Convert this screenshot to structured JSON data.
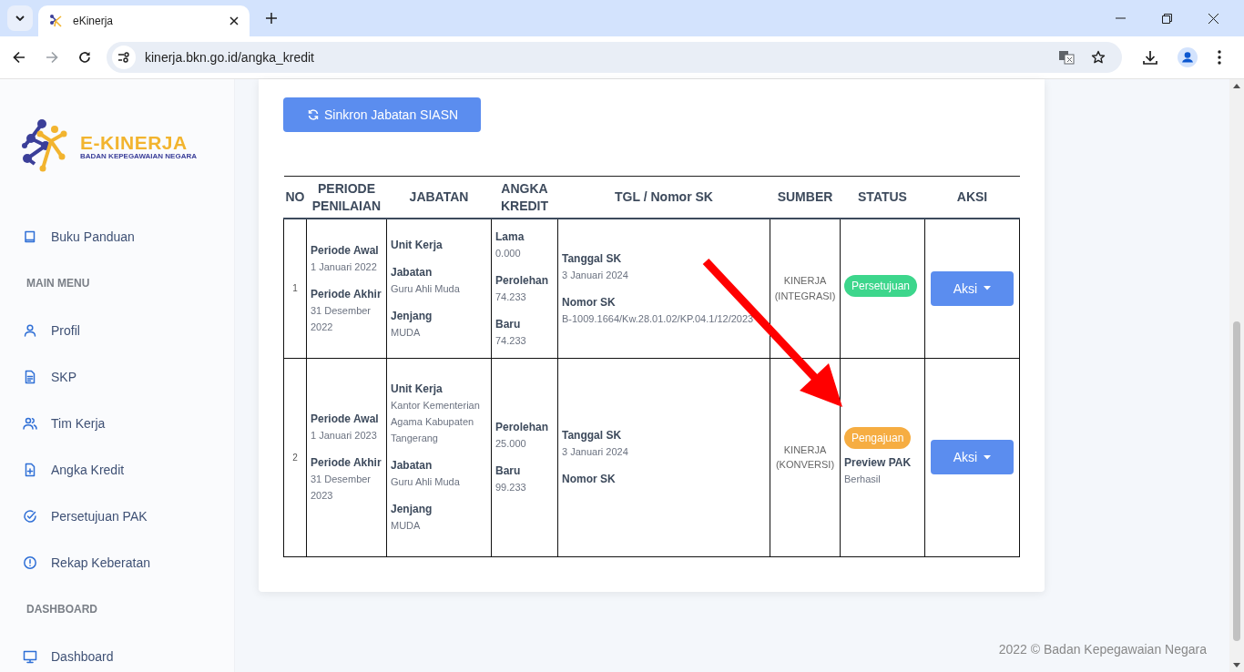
{
  "browser": {
    "tab_title": "eKinerja",
    "url": "kinerja.bkn.go.id/angka_kredit"
  },
  "sidebar": {
    "logo": {
      "title": "E-KINERJA",
      "subtitle": "BADAN KEPEGAWAIAN NEGARA"
    },
    "sections": [
      {
        "items": [
          "Buku Panduan"
        ]
      },
      {
        "heading": "MAIN MENU",
        "items": [
          "Profil",
          "SKP",
          "Tim Kerja",
          "Angka Kredit",
          "Persetujuan PAK",
          "Rekap Keberatan"
        ]
      },
      {
        "heading": "DASHBOARD",
        "items": [
          "Dashboard"
        ]
      }
    ]
  },
  "sync_button": "Sinkron Jabatan SIASN",
  "table": {
    "columns": [
      "NO",
      "PERIODE PENILAIAN",
      "JABATAN",
      "ANGKA KREDIT",
      "TGL / Nomor SK",
      "SUMBER",
      "STATUS",
      "AKSI"
    ],
    "rows": [
      {
        "no": "1",
        "periode": [
          {
            "label": "Periode Awal",
            "value": "1 Januari 2022"
          },
          {
            "label": "Periode Akhir",
            "value": "31 Desember 2022"
          }
        ],
        "jabatan": [
          {
            "label": "Unit Kerja"
          },
          {
            "label": "Jabatan",
            "value": "Guru Ahli Muda"
          },
          {
            "label": "Jenjang",
            "value": "MUDA"
          }
        ],
        "angka_kredit": [
          {
            "label": "Lama",
            "value": "0.000"
          },
          {
            "label": "Perolehan",
            "value": "74.233"
          },
          {
            "label": "Baru",
            "value": "74.233"
          }
        ],
        "sk": [
          {
            "label": "Tanggal SK",
            "value": "3 Januari 2024"
          },
          {
            "label": "Nomor SK",
            "value": "B-1009.1664/Kw.28.01.02/KP.04.1/12/2023"
          }
        ],
        "sumber": "KINERJA (INTEGRASI)",
        "status": {
          "label": "Persetujuan",
          "color": "#3dd68c"
        },
        "action": "Aksi"
      },
      {
        "no": "2",
        "periode": [
          {
            "label": "Periode Awal",
            "value": "1 Januari 2023"
          },
          {
            "label": "Periode Akhir",
            "value": "31 Desember 2023"
          }
        ],
        "jabatan": [
          {
            "label": "Unit Kerja",
            "value": "Kantor Kementerian Agama Kabupaten Tangerang"
          },
          {
            "label": "Jabatan",
            "value": "Guru Ahli Muda"
          },
          {
            "label": "Jenjang",
            "value": "MUDA"
          }
        ],
        "angka_kredit": [
          {
            "label": "Perolehan",
            "value": "25.000"
          },
          {
            "label": "Baru",
            "value": "99.233"
          }
        ],
        "sk": [
          {
            "label": "Tanggal SK",
            "value": "3 Januari 2024"
          },
          {
            "label": "Nomor SK"
          }
        ],
        "sumber": "KINERJA (KONVERSI)",
        "status": {
          "label": "Pengajuan",
          "color": "#f6ad42"
        },
        "status_note": {
          "label": "Preview PAK",
          "value": "Berhasil"
        },
        "action": "Aksi"
      }
    ]
  },
  "footer": "2022 © Badan Kepegawaian Negara"
}
